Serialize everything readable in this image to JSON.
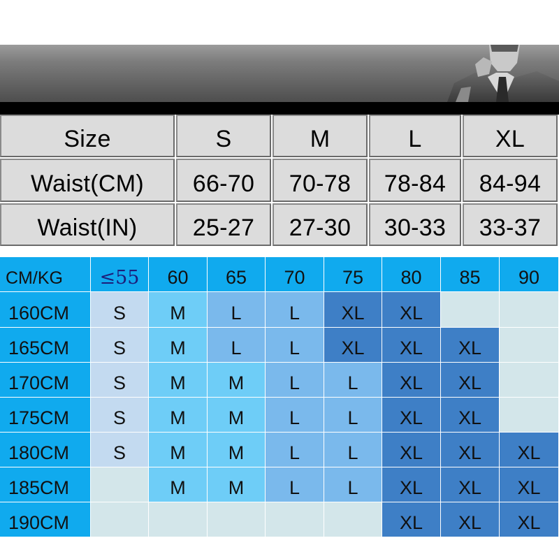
{
  "size_table": {
    "headers": [
      "Size",
      "S",
      "M",
      "L",
      "XL"
    ],
    "rows": [
      [
        "Waist(CM)",
        "66-70",
        "70-78",
        "78-84",
        "84-94"
      ],
      [
        "Waist(IN)",
        "25-27",
        "27-30",
        "30-33",
        "33-37"
      ]
    ]
  },
  "recommendation_chart": {
    "corner_label": "CM/KG",
    "weights": [
      "≤55",
      "60",
      "65",
      "70",
      "75",
      "80",
      "85",
      "90"
    ],
    "heights": [
      "160CM",
      "165CM",
      "170CM",
      "175CM",
      "180CM",
      "185CM",
      "190CM"
    ],
    "cells": [
      [
        "S",
        "M",
        "L",
        "L",
        "XL",
        "XL",
        "",
        ""
      ],
      [
        "S",
        "M",
        "L",
        "L",
        "XL",
        "XL",
        "XL",
        ""
      ],
      [
        "S",
        "M",
        "M",
        "L",
        "L",
        "XL",
        "XL",
        ""
      ],
      [
        "S",
        "M",
        "M",
        "L",
        "L",
        "XL",
        "XL",
        ""
      ],
      [
        "S",
        "M",
        "M",
        "L",
        "L",
        "XL",
        "XL",
        "XL"
      ],
      [
        "",
        "M",
        "M",
        "L",
        "L",
        "XL",
        "XL",
        "XL"
      ],
      [
        "",
        "",
        "",
        "",
        "",
        "XL",
        "XL",
        "XL"
      ]
    ]
  },
  "colors": {
    "header_blue": "#10aaee",
    "size_S": "#c3daf0",
    "size_M": "#6ecdf7",
    "size_L": "#7ab9ec",
    "size_XL": "#3e7fc6",
    "empty": "#d3e6ea"
  }
}
